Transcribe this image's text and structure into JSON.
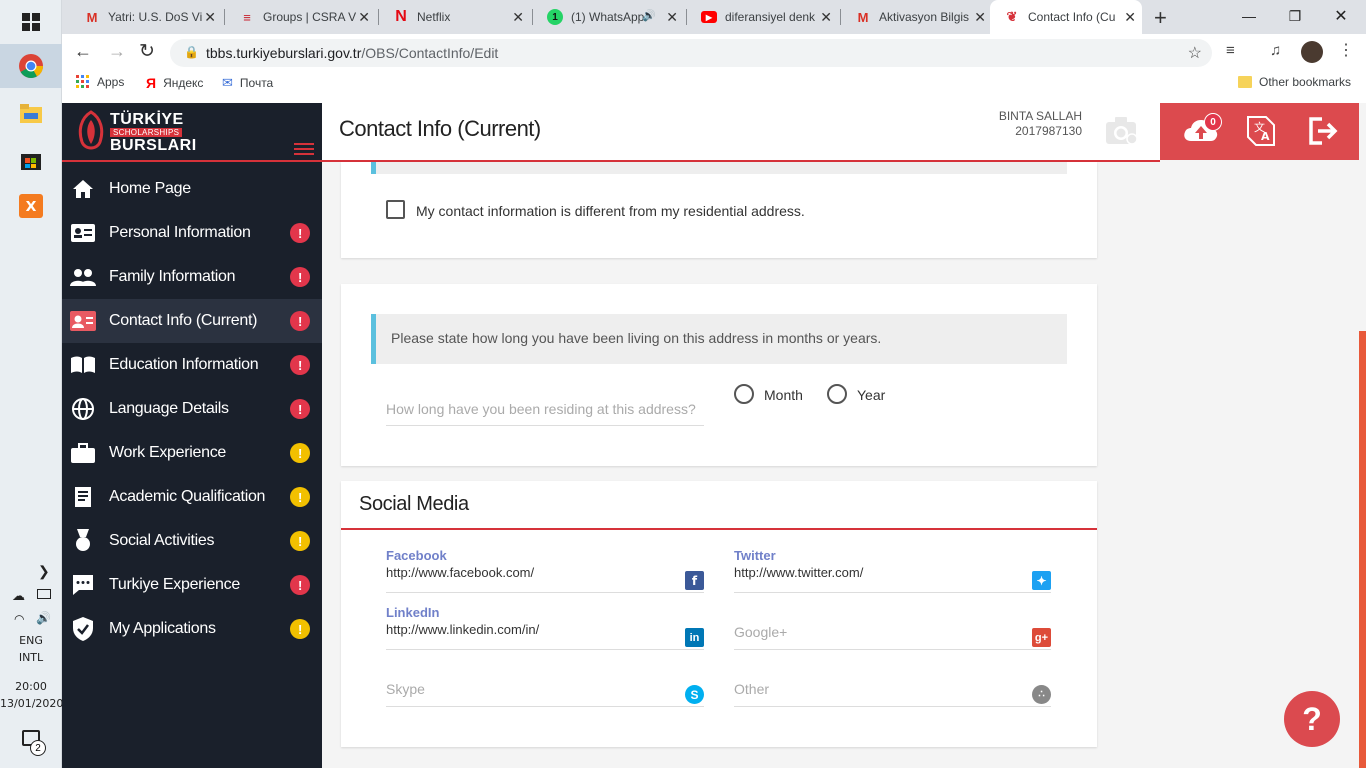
{
  "taskbar": {
    "language": "ENG",
    "layout": "INTL",
    "time": "20:00",
    "date": "13/01/2020",
    "notif_count": "2"
  },
  "browser": {
    "tabs": [
      {
        "title": "Yatri: U.S. DoS Vi"
      },
      {
        "title": "Groups | CSRA V"
      },
      {
        "title": "Netflix"
      },
      {
        "title": "(1) WhatsApp"
      },
      {
        "title": "diferansiyel denk"
      },
      {
        "title": "Aktivasyon Bilgis"
      },
      {
        "title": "Contact Info (Cu"
      }
    ],
    "url_host": "tbbs.turkiyeburslari.gov.tr",
    "url_path": "/OBS/ContactInfo/Edit",
    "bookmarks": [
      "Apps",
      "Яндекс",
      "Почта"
    ],
    "other_bookmarks": "Other bookmarks"
  },
  "logo": {
    "line1": "TÜRKİYE",
    "line2": "SCHOLARSHIPS",
    "line3": "BURSLARI"
  },
  "sidebar": {
    "items": [
      {
        "label": "Home Page",
        "badge": ""
      },
      {
        "label": "Personal Information",
        "badge": "red"
      },
      {
        "label": "Family Information",
        "badge": "red"
      },
      {
        "label": "Contact Info (Current)",
        "badge": "red"
      },
      {
        "label": "Education Information",
        "badge": "red"
      },
      {
        "label": "Language Details",
        "badge": "red"
      },
      {
        "label": "Work Experience",
        "badge": "yellow"
      },
      {
        "label": "Academic Qualification",
        "badge": "yellow"
      },
      {
        "label": "Social Activities",
        "badge": "yellow"
      },
      {
        "label": "Turkiye Experience",
        "badge": "red"
      },
      {
        "label": "My Applications",
        "badge": "yellow"
      }
    ],
    "badge_symbol": "!"
  },
  "header": {
    "title": "Contact Info (Current)",
    "user_name": "BINTA SALLAH",
    "user_id": "2017987130",
    "upload_count": "0"
  },
  "contact": {
    "checkbox_label": "My contact information is different from my residential address."
  },
  "residence": {
    "info": "Please state how long you have been living on this address in months or years.",
    "duration_placeholder": "How long have you been residing at this address?",
    "month_label": "Month",
    "year_label": "Year"
  },
  "social": {
    "title": "Social Media",
    "facebook_label": "Facebook",
    "facebook_value": "http://www.facebook.com/",
    "twitter_label": "Twitter",
    "twitter_value": "http://www.twitter.com/",
    "linkedin_label": "LinkedIn",
    "linkedin_value": "http://www.linkedin.com/in/",
    "google_placeholder": "Google+",
    "skype_placeholder": "Skype",
    "other_placeholder": "Other"
  },
  "help_label": "?",
  "colors": {
    "sidebar_bg": "#1a202b",
    "accent_red": "#d6323a",
    "header_red": "#dc4a4e",
    "label_blue": "#7080c9",
    "info_border": "#5bc0de",
    "badge_red": "#e2364b",
    "badge_yellow": "#f2c000"
  }
}
